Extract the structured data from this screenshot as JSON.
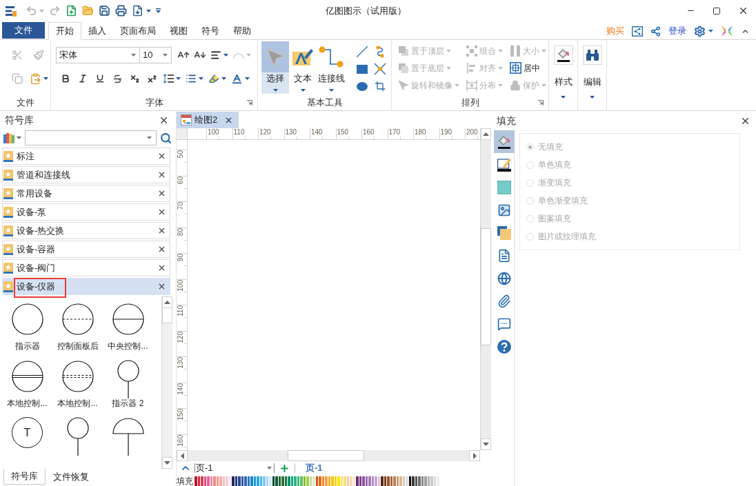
{
  "window": {
    "title": "亿图图示（试用版）"
  },
  "quick_access": {
    "undo": {
      "disabled": true
    },
    "redo": {
      "disabled": true
    }
  },
  "menu": {
    "file_button": "文件",
    "tabs": [
      {
        "label": "开始",
        "selected": true
      },
      {
        "label": "插入",
        "selected": false
      },
      {
        "label": "页面布局",
        "selected": false
      },
      {
        "label": "视图",
        "selected": false
      },
      {
        "label": "符号",
        "selected": false
      },
      {
        "label": "帮助",
        "selected": false
      }
    ],
    "buy": "购买",
    "login": "登录"
  },
  "ribbon": {
    "file_group": {
      "label": "文件",
      "tools": [
        {
          "disabled": true
        },
        {
          "disabled": true
        },
        {
          "disabled": true
        },
        {
          "disabled": false
        }
      ]
    },
    "font_group": {
      "label": "字体",
      "font_name": "宋体",
      "font_size": "10",
      "text_arc": {
        "disabled": true
      }
    },
    "tools_group": {
      "label": "基本工具",
      "tools": [
        {
          "label": "选择",
          "selected": true
        },
        {
          "label": "文本",
          "selected": false
        },
        {
          "label": "连接线",
          "selected": false
        }
      ]
    },
    "arrange_group": {
      "label": "排列",
      "commands": [
        {
          "label": "置于顶层",
          "disabled": true,
          "dropdown": true
        },
        {
          "label": "组合",
          "disabled": true,
          "dropdown": true
        },
        {
          "label": "大小",
          "disabled": true,
          "dropdown": true
        },
        {
          "label": "置于底层",
          "disabled": true,
          "dropdown": true
        },
        {
          "label": "对齐",
          "disabled": true,
          "dropdown": true
        },
        {
          "label": "居中",
          "disabled": false,
          "dropdown": false
        },
        {
          "label": "旋转和镜像",
          "disabled": true,
          "dropdown": true
        },
        {
          "label": "分布",
          "disabled": true,
          "dropdown": true
        },
        {
          "label": "保护",
          "disabled": true,
          "dropdown": true
        }
      ]
    },
    "style_button": "样式",
    "edit_button": "编辑"
  },
  "symbol_library": {
    "title": "符号库",
    "categories": [
      {
        "label": "标注",
        "selected": false,
        "highlighted": false
      },
      {
        "label": "管道和连接线",
        "selected": false,
        "highlighted": false
      },
      {
        "label": "常用设备",
        "selected": false,
        "highlighted": false
      },
      {
        "label": "设备-泵",
        "selected": false,
        "highlighted": false
      },
      {
        "label": "设备-热交换",
        "selected": false,
        "highlighted": false
      },
      {
        "label": "设备-容器",
        "selected": false,
        "highlighted": false
      },
      {
        "label": "设备-阀门",
        "selected": false,
        "highlighted": false
      },
      {
        "label": "设备-仪器",
        "selected": true,
        "highlighted": true
      }
    ],
    "shapes": [
      {
        "kind": "circle",
        "label": "指示器"
      },
      {
        "kind": "dashed",
        "label": "控制面板后"
      },
      {
        "kind": "line",
        "label": "中央控制..."
      },
      {
        "kind": "double-line",
        "label": "本地控制..."
      },
      {
        "kind": "double-dashed",
        "label": "本地控制..."
      },
      {
        "kind": "stem",
        "label": "指示器 2"
      },
      {
        "kind": "letter",
        "glyph": "T"
      },
      {
        "kind": "stem"
      },
      {
        "kind": "dome"
      }
    ],
    "bottom_tabs": [
      {
        "label": "符号库",
        "selected": true
      },
      {
        "label": "文件恢复",
        "selected": false
      }
    ]
  },
  "document_tab": {
    "label": "绘图2"
  },
  "ruler": {
    "horizontal": [
      "100",
      "110",
      "120",
      "130",
      "140",
      "150",
      "160",
      "170",
      "180",
      "190",
      "200"
    ],
    "vertical": [
      "50",
      "60",
      "70",
      "80",
      "90",
      "100",
      "110",
      "120",
      "130",
      "140",
      "150",
      "160"
    ]
  },
  "page_bar": {
    "page_select": "页-1",
    "pages": [
      {
        "label": "页-1",
        "selected": true
      }
    ]
  },
  "color_bar": {
    "label": "填充",
    "swatches": [
      {
        "color": "#c8102e"
      },
      {
        "color": "#d42a3c"
      },
      {
        "color": "#dc3c5a"
      },
      {
        "color": "#e0507a"
      },
      {
        "color": "#e4609a"
      },
      {
        "color": "#e58fb0"
      },
      {
        "color": "#ec8a8a"
      },
      {
        "color": "#f09a8e"
      },
      {
        "color": "#f4ada2"
      },
      {
        "color": "#f6c2bc"
      },
      {
        "color": "#f0d2e2"
      },
      {
        "color": "#fae3ee"
      },
      {
        "color": "#1d2b5a"
      },
      {
        "color": "#233877"
      },
      {
        "color": "#28478d"
      },
      {
        "color": "#2a56a5"
      },
      {
        "color": "#3467b8"
      },
      {
        "color": "#2a75b8"
      },
      {
        "color": "#1a86c9"
      },
      {
        "color": "#1c97d8"
      },
      {
        "color": "#2aa8e2"
      },
      {
        "color": "#3fbbec"
      },
      {
        "color": "#8ac5ea"
      },
      {
        "color": "#a9d4ed"
      },
      {
        "color": "#cfe6ef"
      },
      {
        "color": "#0b4a2e"
      },
      {
        "color": "#0f5a39"
      },
      {
        "color": "#1a6a3e"
      },
      {
        "color": "#3c6e2d"
      },
      {
        "color": "#0d7c4f"
      },
      {
        "color": "#0f9569"
      },
      {
        "color": "#19a67e"
      },
      {
        "color": "#2bb38b"
      },
      {
        "color": "#43b97a"
      },
      {
        "color": "#60c06b"
      },
      {
        "color": "#8bbd2b"
      },
      {
        "color": "#a7c94f"
      },
      {
        "color": "#c5dba3"
      },
      {
        "color": "#dbe9cd"
      },
      {
        "color": "#e04f1a"
      },
      {
        "color": "#e8691a"
      },
      {
        "color": "#ef8a35"
      },
      {
        "color": "#f2a24f"
      },
      {
        "color": "#f5b11a"
      },
      {
        "color": "#f7c21c"
      },
      {
        "color": "#f9d31d"
      },
      {
        "color": "#fae500"
      },
      {
        "color": "#f9ec6c"
      },
      {
        "color": "#f8dc8b"
      },
      {
        "color": "#f3cf98"
      },
      {
        "color": "#f4dcb9"
      },
      {
        "color": "#f8e9cf"
      },
      {
        "color": "#6a2d77"
      },
      {
        "color": "#7a3f8e"
      },
      {
        "color": "#8a539b"
      },
      {
        "color": "#9b69ae"
      },
      {
        "color": "#a77cb6"
      },
      {
        "color": "#b590c3"
      },
      {
        "color": "#c8a9d1"
      },
      {
        "color": "#e4c6de"
      },
      {
        "color": "#5a2c15"
      },
      {
        "color": "#7a3e1d"
      },
      {
        "color": "#93552c"
      },
      {
        "color": "#a96b3e"
      },
      {
        "color": "#b98558"
      },
      {
        "color": "#caa17b"
      },
      {
        "color": "#ddb991"
      },
      {
        "color": "#d4cec6"
      },
      {
        "color": "#e6e3dd"
      },
      {
        "color": "#111111"
      },
      {
        "color": "#3a3a3a"
      },
      {
        "color": "#555555"
      },
      {
        "color": "#6e6e6e"
      },
      {
        "color": "#888888"
      },
      {
        "color": "#9e9e9e"
      },
      {
        "color": "#b4b4b4"
      },
      {
        "color": "#c9c9c9"
      },
      {
        "color": "#dcdcdc"
      },
      {
        "color": "#ededed"
      }
    ]
  },
  "fill_panel": {
    "title": "填充",
    "side_tools": [
      {
        "selected": true
      },
      {
        "selected": false
      },
      {
        "selected": false
      },
      {
        "selected": false
      },
      {
        "selected": false
      },
      {
        "selected": false
      },
      {
        "selected": false
      },
      {
        "selected": false
      },
      {
        "selected": false
      },
      {
        "selected": false
      }
    ],
    "options": [
      {
        "label": "无填充",
        "selected": true,
        "disabled": true
      },
      {
        "label": "单色填充",
        "selected": false,
        "disabled": true
      },
      {
        "label": "渐变填充",
        "selected": false,
        "disabled": true
      },
      {
        "label": "单色渐变填充",
        "selected": false,
        "disabled": true
      },
      {
        "label": "图案填充",
        "selected": false,
        "disabled": true
      },
      {
        "label": "图片或纹理填充",
        "selected": false,
        "disabled": true
      }
    ]
  }
}
